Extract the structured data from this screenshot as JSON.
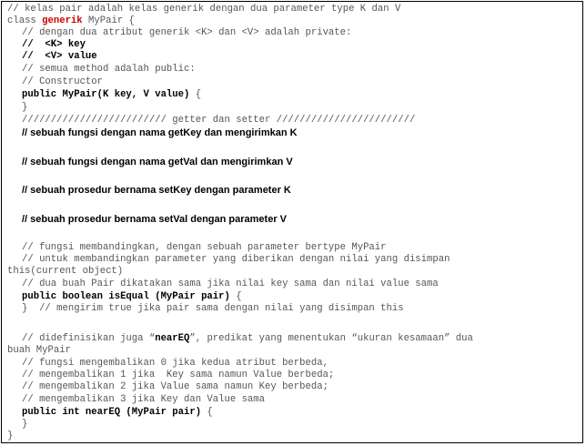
{
  "lines": {
    "l01": "// kelas pair adalah kelas generik dengan dua parameter type K dan V",
    "l02a": "class ",
    "l02b": "generik",
    "l02c": " MyPair {",
    "l03": "// dengan dua atribut generik <K> dan <V> adalah private:",
    "l04": "//  <K> key",
    "l05": "//  <V> value",
    "l06": "// semua method adalah public:",
    "l07": "// Constructor",
    "l08a": "public MyPair(K key, V value)",
    "l08b": " {",
    "l09": "}",
    "l10": "///////////////////////// getter dan setter ////////////////////////",
    "l11": "// sebuah fungsi dengan nama getKey dan mengirimkan K",
    "l12": "// sebuah fungsi dengan nama getVal dan mengirimkan V",
    "l13": "// sebuah prosedur bernama setKey dengan parameter K",
    "l14": "// sebuah prosedur bernama setVal dengan parameter V",
    "l15": "// fungsi membandingkan, dengan sebuah parameter bertype MyPair",
    "l16": "// untuk membandingkan parameter yang diberikan dengan nilai yang disimpan",
    "l17": "this(current object)",
    "l18": "// dua buah Pair dikatakan sama jika nilai key sama dan nilai value sama",
    "l19a": "public boolean isEqual (MyPair pair)",
    "l19b": " {",
    "l20": "}  // mengirim true jika pair sama dengan nilai yang disimpan this",
    "l21a": "// didefinisikan juga “",
    "l21b": "nearEQ",
    "l21c": "”, predikat yang menentukan “ukuran kesamaan” dua",
    "l22": "buah MyPair",
    "l23": "// fungsi mengembalikan 0 jika kedua atribut berbeda,",
    "l24": "// mengembalikan 1 jika  Key sama namun Value berbeda;",
    "l25": "// mengembalikan 2 jika Value sama namun Key berbeda;",
    "l26": "// mengembalikan 3 jika Key dan Value sama",
    "l27a": "public int nearEQ (MyPair pair)",
    "l27b": " {",
    "l28": "}",
    "l29": "}"
  }
}
